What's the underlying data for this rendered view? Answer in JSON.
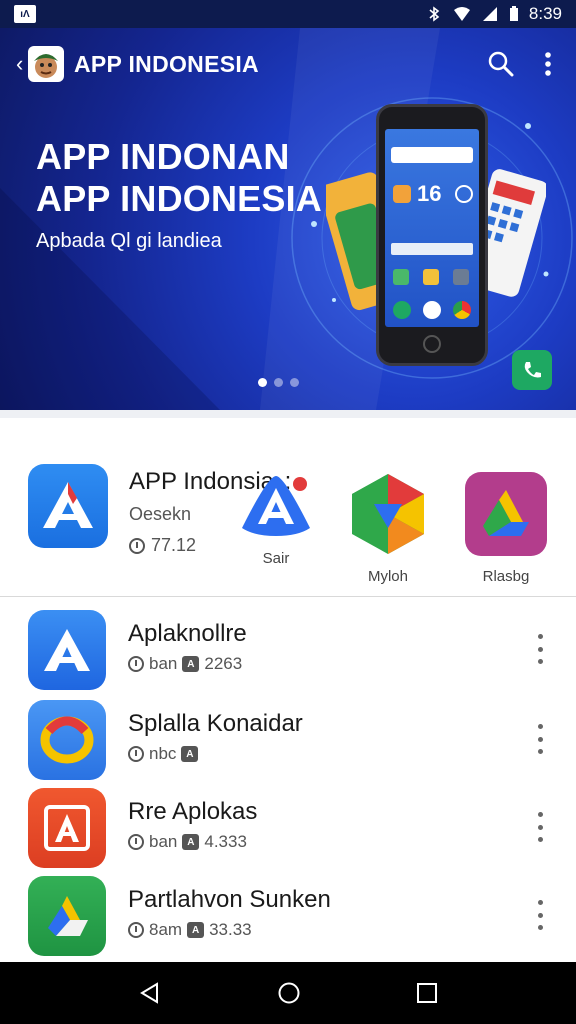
{
  "status_bar": {
    "time": "8:39"
  },
  "appbar": {
    "title": "APP INDONESIA"
  },
  "hero": {
    "title_line1": "APP INDONAN",
    "title_line2": "APP INDONESIA",
    "subtitle": "Apbada Ql gi landiea",
    "phone_clock": "16",
    "carousel_pages": 3,
    "carousel_active": 1
  },
  "featured": {
    "title": "APP Indonsia",
    "title_suffix": ":",
    "subtitle": "Oesekn",
    "meta": "77.12",
    "apps": [
      {
        "label": "Sair"
      },
      {
        "label": "Myloh"
      },
      {
        "label": "Rlasbg"
      }
    ]
  },
  "list": [
    {
      "name": "Aplaknollre",
      "meta1": "ban",
      "meta2": "2263"
    },
    {
      "name": "Splalla Konaidar",
      "meta1": "nbc",
      "meta2": ""
    },
    {
      "name": "Rre Aplokas",
      "meta1": "ban",
      "meta2": "4.333"
    },
    {
      "name": "Partlahvon Sunken",
      "meta1": "8am",
      "meta2": "33.33"
    }
  ],
  "colors": {
    "hero_bg": "#1d3cc4",
    "featured_icon_bg": "#2f8df2",
    "row1_icon_bg": "#2b7fea",
    "row2_icon_bg": "#3a8cf0",
    "row3_icon_bg": "#ea4a2a",
    "row4_icon_bg": "#27a24a",
    "navbar_bg": "#000000"
  },
  "icons": {
    "status_left": "notification-app-icon",
    "status_right": [
      "bluetooth-icon",
      "wifi-icon",
      "signal-icon",
      "battery-icon"
    ],
    "appbar": [
      "back-icon",
      "avatar",
      "search-icon",
      "more-vert-icon"
    ],
    "navbar": [
      "back-triangle-icon",
      "home-circle-icon",
      "recents-square-icon"
    ]
  }
}
